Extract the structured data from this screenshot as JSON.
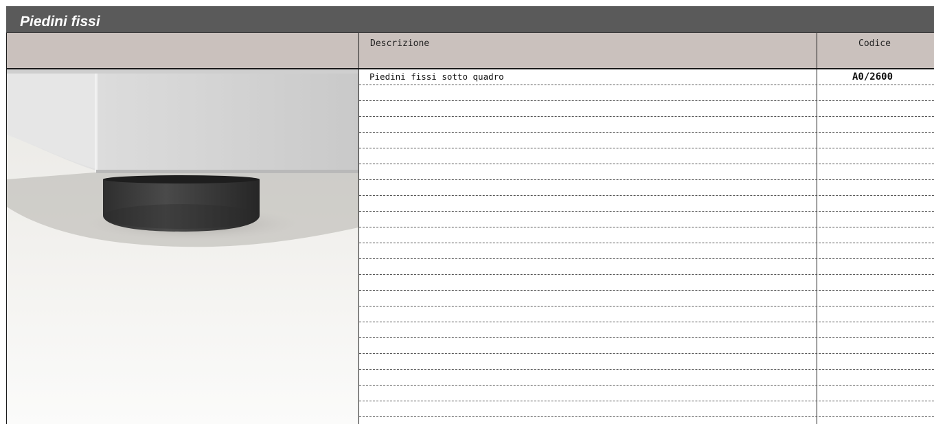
{
  "section": {
    "title": "Piedini fissi"
  },
  "table": {
    "headers": {
      "description": "Descrizione",
      "code": "Codice"
    },
    "rows": [
      {
        "description": "Piedini fissi sotto quadro",
        "code": "A0/2600"
      },
      {
        "description": "",
        "code": ""
      },
      {
        "description": "",
        "code": ""
      },
      {
        "description": "",
        "code": ""
      },
      {
        "description": "",
        "code": ""
      },
      {
        "description": "",
        "code": ""
      },
      {
        "description": "",
        "code": ""
      },
      {
        "description": "",
        "code": ""
      },
      {
        "description": "",
        "code": ""
      },
      {
        "description": "",
        "code": ""
      },
      {
        "description": "",
        "code": ""
      },
      {
        "description": "",
        "code": ""
      },
      {
        "description": "",
        "code": ""
      },
      {
        "description": "",
        "code": ""
      },
      {
        "description": "",
        "code": ""
      },
      {
        "description": "",
        "code": ""
      },
      {
        "description": "",
        "code": ""
      },
      {
        "description": "",
        "code": ""
      },
      {
        "description": "",
        "code": ""
      },
      {
        "description": "",
        "code": ""
      },
      {
        "description": "",
        "code": ""
      },
      {
        "description": "",
        "code": ""
      }
    ]
  },
  "photo": {
    "icon": "fixed-foot-product-photo"
  },
  "colors": {
    "title_bar": "#5a5a5a",
    "header_row": "#cac1bd"
  }
}
